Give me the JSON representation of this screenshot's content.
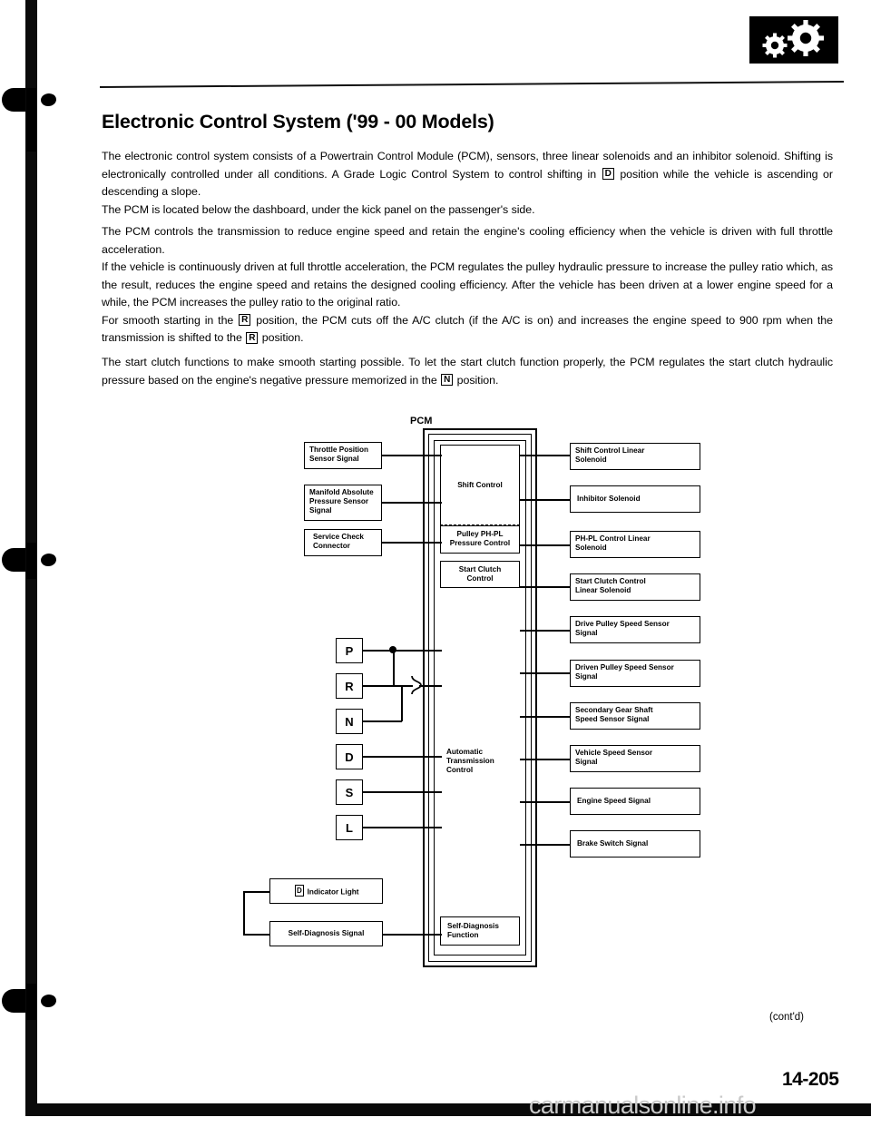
{
  "document": {
    "title": "Electronic Control System ('99 - 00 Models)",
    "page_number": "14-205",
    "continued_label": "(cont'd)",
    "watermark": "carmanualsonline.info",
    "logo_name": "gears-logo"
  },
  "paragraphs": {
    "p1_a": "The electronic control system consists of a Powertrain Control Module (PCM), sensors, three linear solenoids and an inhibitor solenoid. Shifting is electronically controlled under all conditions. A Grade Logic Control System to control shifting in ",
    "p1_gear": "D",
    "p1_b": " position while the vehicle is ascending or descending a slope.",
    "p1_c": "The PCM is located below the dashboard, under the kick panel on the passenger's side.",
    "p2_a": "The PCM controls the transmission to reduce engine speed and retain the engine's cooling efficiency when the vehicle is driven with full throttle acceleration.",
    "p2_b": "If the vehicle is continuously driven at full throttle acceleration, the PCM regulates the pulley hydraulic pressure to increase the pulley ratio which, as the result, reduces the engine speed and retains the designed cooling efficiency. After the vehicle has been driven at a lower engine speed for a while, the PCM increases the pulley ratio to the original ratio.",
    "p2_c1": "For smooth starting in the ",
    "p2_gear1": "R",
    "p2_c2": " position, the PCM cuts off the A/C clutch (if the A/C is on) and increases the engine speed to 900 rpm when the transmission is shifted to the ",
    "p2_gear2": "R",
    "p2_c3": " position.",
    "p3_a": "The start clutch functions to make smooth starting possible. To let the start clutch function properly, the PCM regulates the start clutch hydraulic pressure based on the engine's negative pressure memorized in the ",
    "p3_gear": "N",
    "p3_b": " position."
  },
  "diagram": {
    "pcm_label": "PCM",
    "inputs": [
      {
        "id": "throttle-position-sensor-signal",
        "label": "Throttle Position\nSensor Signal"
      },
      {
        "id": "manifold-absolute-pressure-sensor-signal",
        "label": "Manifold Absolute\nPressure Sensor\nSignal"
      },
      {
        "id": "service-check-connector",
        "label": "Service Check\nConnector"
      }
    ],
    "pcm_blocks": [
      {
        "id": "shift-control",
        "label": "Shift Control"
      },
      {
        "id": "pulley-ph-pl-pressure-control",
        "label": "Pulley PH-PL\nPressure Control"
      },
      {
        "id": "start-clutch-control",
        "label": "Start Clutch\nControl"
      },
      {
        "id": "automatic-transmission-control",
        "label": "Automatic\nTransmission\nControl"
      },
      {
        "id": "self-diagnosis-function",
        "label": "Self-Diagnosis\nFunction"
      }
    ],
    "outputs": [
      {
        "id": "shift-control-linear-solenoid",
        "label": "Shift Control Linear\nSolenoid"
      },
      {
        "id": "inhibitor-solenoid",
        "label": "Inhibitor Solenoid"
      },
      {
        "id": "ph-pl-control-linear-solenoid",
        "label": "PH-PL Control Linear\nSolenoid"
      },
      {
        "id": "start-clutch-control-linear-solenoid",
        "label": "Start Clutch Control\nLinear Solenoid"
      },
      {
        "id": "drive-pulley-speed-sensor-signal",
        "label": "Drive Pulley Speed Sensor\nSignal"
      },
      {
        "id": "driven-pulley-speed-sensor-signal",
        "label": "Driven Pulley Speed Sensor\nSignal"
      },
      {
        "id": "secondary-gear-shaft-speed-sensor-signal",
        "label": "Secondary Gear Shaft\nSpeed Sensor Signal"
      },
      {
        "id": "vehicle-speed-sensor-signal",
        "label": "Vehicle Speed Sensor\nSignal"
      },
      {
        "id": "engine-speed-signal",
        "label": "Engine Speed Signal"
      },
      {
        "id": "brake-switch-signal",
        "label": "Brake Switch Signal"
      }
    ],
    "gear_positions": [
      "P",
      "R",
      "N",
      "D",
      "S",
      "L"
    ],
    "bottom_boxes": [
      {
        "id": "d-indicator-light",
        "gear": "D",
        "label": " Indicator Light"
      },
      {
        "id": "self-diagnosis-signal",
        "label": "Self-Diagnosis Signal"
      }
    ]
  }
}
